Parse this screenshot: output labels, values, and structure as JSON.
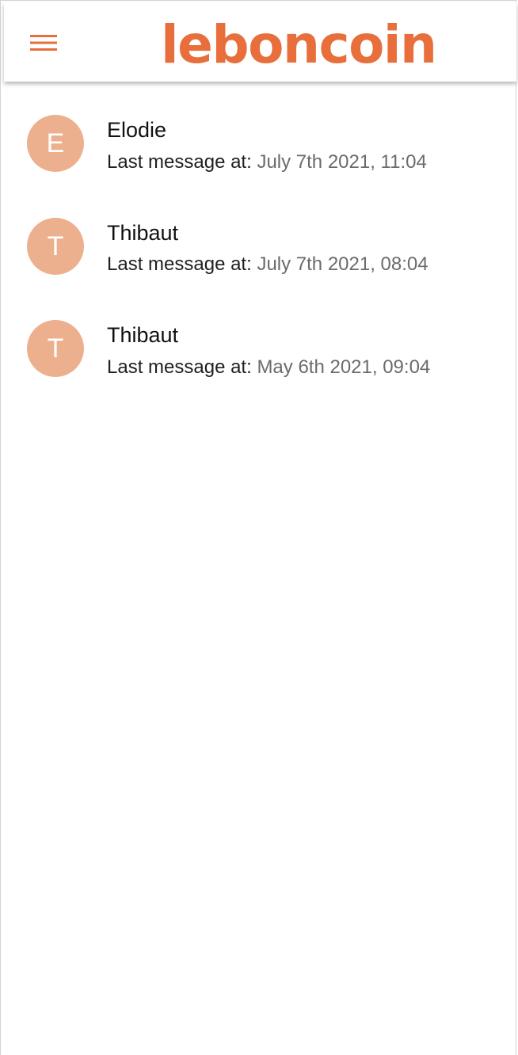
{
  "header": {
    "logo_text": "leboncoin",
    "menu_icon": "hamburger-menu-icon",
    "brand_color": "#e86f3b"
  },
  "conversations": [
    {
      "initial": "E",
      "name": "Elodie",
      "last_message_label": "Last message at:",
      "timestamp": "July 7th 2021, 11:04"
    },
    {
      "initial": "T",
      "name": "Thibaut",
      "last_message_label": "Last message at:",
      "timestamp": "July 7th 2021, 08:04"
    },
    {
      "initial": "T",
      "name": "Thibaut",
      "last_message_label": "Last message at:",
      "timestamp": "May 6th 2021, 09:04"
    }
  ],
  "colors": {
    "avatar_bg": "#ecb08e",
    "timestamp": "#6b6b6b"
  }
}
